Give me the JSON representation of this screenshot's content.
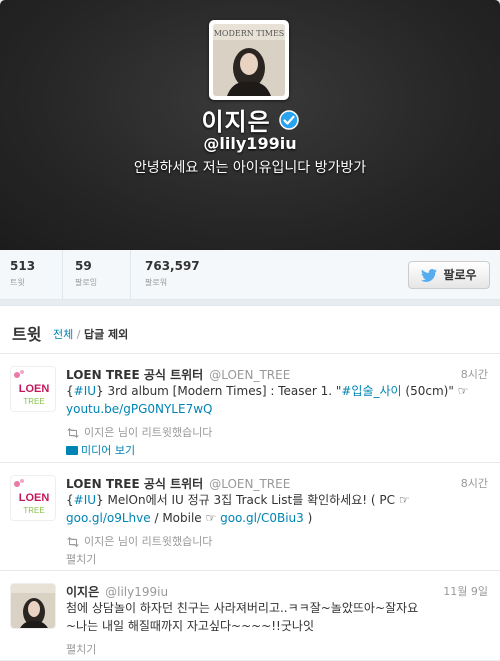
{
  "profile": {
    "name": "이지은",
    "handle": "@lily199iu",
    "bio": "안녕하세요 저는 아이유입니다 방가방가",
    "avatar_text": "MODERN TIMES"
  },
  "stats": [
    {
      "value": "513",
      "label": "트윗"
    },
    {
      "value": "59",
      "label": "팔로잉"
    },
    {
      "value": "763,597",
      "label": "팔로워"
    }
  ],
  "follow_button": {
    "label": "팔로우"
  },
  "tweets_section": {
    "heading": "트윗",
    "filter_all": "전체",
    "filter_sep": "/",
    "filter_no_replies": "답글 제외"
  },
  "tweets": [
    {
      "author": "LOEN TREE 공식 트위터",
      "handle": "@LOEN_TREE",
      "time": "8시간",
      "avatar_line1": "LOEN",
      "avatar_line2": "TREE",
      "text_parts": [
        "{",
        "#IU",
        "} 3rd album [Modern Times] : Teaser 1. \"",
        "#입술_사이",
        " (50cm)\" ☞ "
      ],
      "link": "youtu.be/gPG0NYLE7wQ",
      "retweeted_by": "이지은 님이 리트윗했습니다",
      "action": "미디어 보기"
    },
    {
      "author": "LOEN TREE 공식 트위터",
      "handle": "@LOEN_TREE",
      "time": "8시간",
      "avatar_line1": "LOEN",
      "avatar_line2": "TREE",
      "text_parts": [
        "{",
        "#IU",
        "} MelOn에서 IU 정규 3집 Track List를 확인하세요! ( PC ☞ "
      ],
      "link_a": "goo.gl/o9Lhve",
      "mid": " / Mobile ☞ ",
      "link_b": "goo.gl/C0Biu3",
      "tail": " )",
      "retweeted_by": "이지은 님이 리트윗했습니다",
      "action": "펼치기"
    },
    {
      "author": "이지은",
      "handle": "@lily199iu",
      "time": "11월 9일",
      "line1": "첨에 상담놀이 하자던 친구는 사라져버리고..ㅋㅋ잘~놀았뜨아~잘자요",
      "line2": "~나는 내일 해질때까지 자고싶다~~~~!!굿나잇",
      "action": "펼치기"
    }
  ],
  "colors": {
    "link": "#0084b4",
    "muted": "#999999",
    "header_bg": "#262626",
    "verified": "#2aa3ef"
  }
}
